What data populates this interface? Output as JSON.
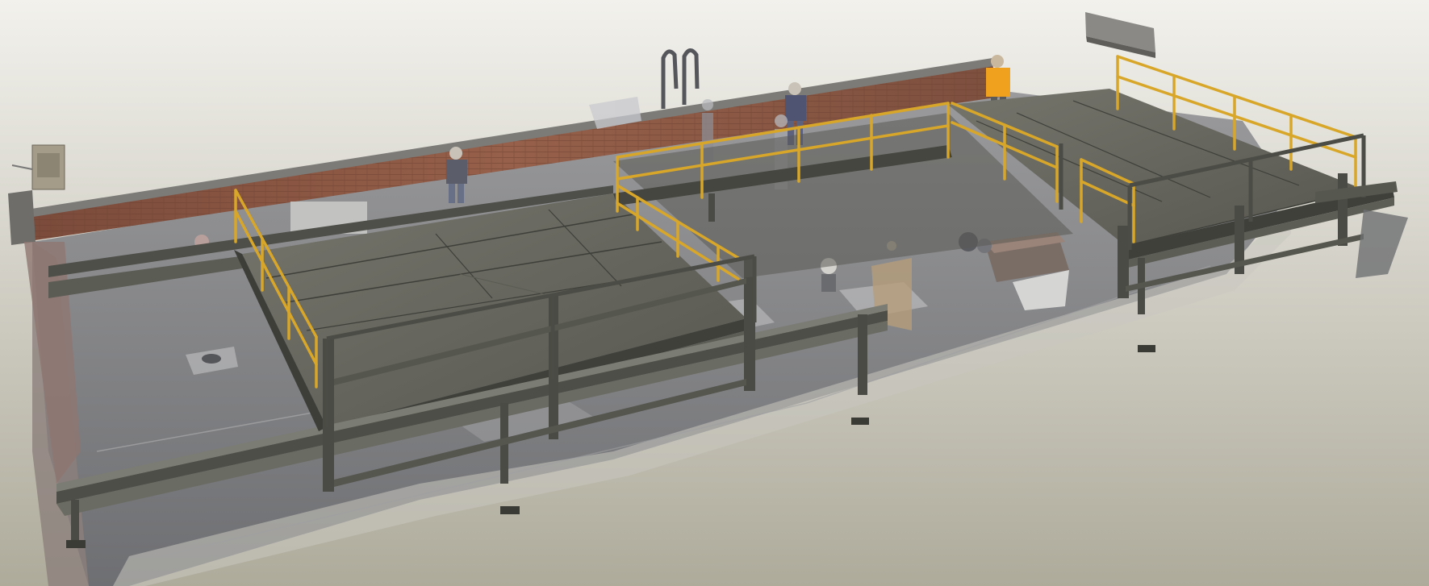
{
  "scene": {
    "kind": "3d-model-viewport",
    "description_visible_text": "",
    "colors": {
      "background_top": "#f2f1ec",
      "background_bottom": "#aeab9b",
      "roof_slab": "#8a8a8c",
      "roof_slab_dark": "#5f6064",
      "parapet_brick": "#8b5a45",
      "parapet_cap": "#7c7b78",
      "platform_deck": "#6a6a61",
      "platform_deck_dark": "#4e4e47",
      "steel_frame": "#4c4d46",
      "steel_frame_light": "#6b6c63",
      "guardrail_yellow": "#d8a72a",
      "worker_orange": "#f0a11e",
      "worker_grey": "#5b5d6b"
    },
    "objects": [
      "roof-point-cloud",
      "brick-parapet-wall",
      "steel-platform-left",
      "steel-platform-center",
      "steel-platform-right",
      "yellow-guardrails",
      "roof-access-ladder",
      "rooftop-workers",
      "hvac-unit",
      "electrical-box"
    ]
  }
}
